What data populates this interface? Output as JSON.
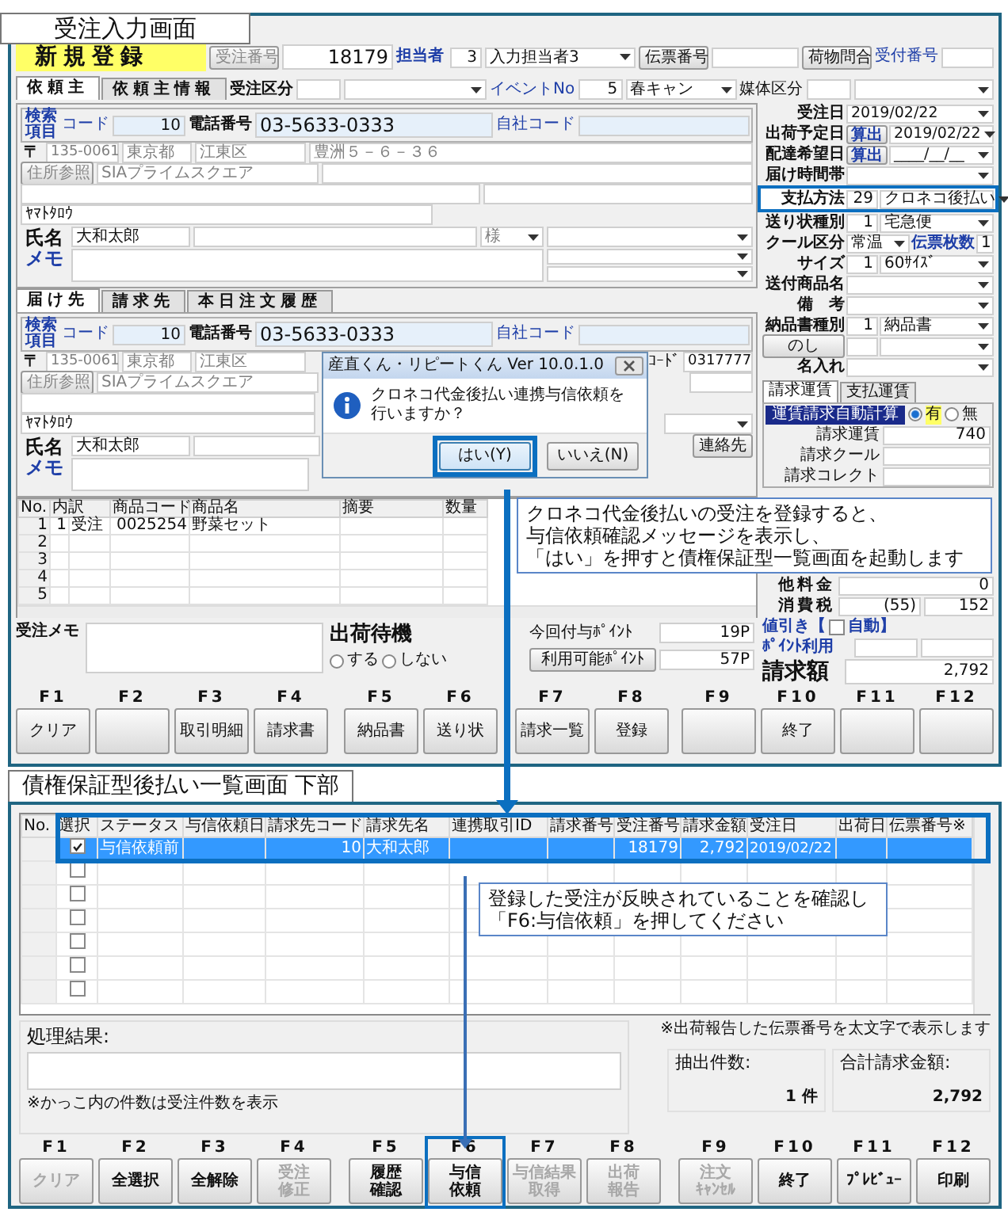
{
  "order_screen": {
    "caption": "受注入力画面",
    "mode": "新規登録",
    "order_no": {
      "button": "受注番号",
      "value": "18179"
    },
    "staff": {
      "label": "担当者",
      "code": "3",
      "name": "入力担当者3"
    },
    "slip_no": {
      "button": "伝票番号"
    },
    "parcel_button": "荷物問合",
    "receipt_label": "受付番号",
    "client_tabs": [
      {
        "label": "依頼主",
        "selected": true
      },
      {
        "label": "依頼主情報",
        "selected": false
      }
    ],
    "order_type": {
      "label": "受注区分"
    },
    "event": {
      "label": "イベントNo",
      "code": "5",
      "name": "春キャン"
    },
    "media": {
      "label": "媒体区分"
    },
    "client": {
      "search_label": "検索項目",
      "code_label": "コード",
      "code": "10",
      "phone_label": "電話番号",
      "phone": "03-5633-0333",
      "own_code_label": "自社コード",
      "zip_mark": "〒",
      "zip": "135-0061",
      "prefecture": "東京都",
      "city": "江東区",
      "street": "豊洲５－６－３６",
      "address_button": "住所参照",
      "building": "SIAプライムスクエア",
      "kana": "ﾔﾏﾄﾀﾛｳ",
      "name_label": "氏名",
      "name": "大和太郎",
      "honorific": "様",
      "memo_label": "メモ"
    },
    "delivery_tabs": [
      {
        "label": "届け先",
        "selected": true
      },
      {
        "label": "請求先",
        "selected": false
      },
      {
        "label": "本日注文履歴",
        "selected": false
      }
    ],
    "delivery": {
      "search_label": "検索項目",
      "code_label": "コード",
      "code": "10",
      "phone_label": "電話番号",
      "phone": "03-5633-0333",
      "own_code_label": "自社コード",
      "zip_mark": "〒",
      "zip": "135-0061",
      "prefecture": "東京都",
      "city": "江東区",
      "address_button": "住所参照",
      "building": "SIAプライムスクエア",
      "kana": "ﾔﾏﾄﾀﾛｳ",
      "name_label": "氏名",
      "name": "大和太郎",
      "memo_label": "メモ",
      "customer_code_label": "ｺｰﾄﾞ",
      "customer_code": "0317777",
      "contact_button": "連絡先"
    },
    "items": {
      "columns": [
        {
          "label": "No."
        },
        {
          "label": "内訳"
        },
        {
          "label": "商品コード"
        },
        {
          "label": "商品名"
        },
        {
          "label": "摘要"
        },
        {
          "label": "数量"
        }
      ],
      "rows": [
        {
          "no": "1",
          "cells": [
            "1",
            "受注",
            "0025254",
            "野菜セット"
          ]
        },
        {
          "no": "2"
        },
        {
          "no": "3"
        },
        {
          "no": "4"
        },
        {
          "no": "5"
        }
      ]
    },
    "memo_label": "受注メモ",
    "shipping_hold": {
      "label": "出荷待機",
      "options": [
        {
          "label": "する",
          "selected": false
        },
        {
          "label": "しない",
          "selected": false
        }
      ]
    },
    "points": [
      {
        "kind": "label",
        "label": "今回付与ﾎﾟｲﾝﾄ",
        "value": "19P"
      },
      {
        "kind": "button",
        "label": "利用可能ﾎﾟｲﾝﾄ",
        "value": "57P"
      }
    ],
    "side_fields": [
      {
        "kind": "date",
        "label": "受注日",
        "value": "2019/02/22",
        "highlighted": false
      },
      {
        "kind": "date",
        "label": "出荷予定日",
        "button": "算出",
        "value": "2019/02/22",
        "highlighted": false
      },
      {
        "kind": "date",
        "label": "配達希望日",
        "button": "算出",
        "value": "____/__/__",
        "highlighted": false
      },
      {
        "kind": "select",
        "label": "届け時間帯",
        "highlighted": false
      },
      {
        "kind": "select",
        "label": "支払方法",
        "code": "29",
        "value": "クロネコ後払い",
        "highlighted": true
      },
      {
        "kind": "select",
        "label": "送り状種別",
        "code": "1",
        "value": "宅急便",
        "highlighted": false
      },
      {
        "kind": "split",
        "label": "クール区分",
        "value": "常温",
        "count_label": "伝票枚数",
        "count": "1",
        "highlighted": false
      },
      {
        "kind": "select",
        "label": "サイズ",
        "code": "1",
        "value": "60ｻｲｽﾞ",
        "highlighted": false
      },
      {
        "kind": "select",
        "label": "送付商品名",
        "highlighted": false
      },
      {
        "kind": "select",
        "label": "備　考",
        "highlighted": false
      },
      {
        "kind": "select",
        "label": "納品書種別",
        "code": "1",
        "value": "納品書",
        "highlighted": false
      },
      {
        "kind": "button",
        "button": "のし",
        "highlighted": false
      },
      {
        "kind": "select",
        "label": "名入れ",
        "highlighted": false
      }
    ],
    "freight": {
      "tabs": [
        {
          "label": "請求運賃",
          "selected": true
        },
        {
          "label": "支払運賃",
          "selected": false
        }
      ],
      "auto_label": "運賃請求自動計算",
      "options": [
        {
          "label": "有",
          "selected": true
        },
        {
          "label": "無",
          "selected": false
        }
      ],
      "rows": [
        {
          "label": "請求運賃",
          "value": "740"
        },
        {
          "label": "請求クール"
        },
        {
          "label": "請求コレクト"
        }
      ]
    },
    "totals": [
      {
        "label": "他料金",
        "value": "0"
      },
      {
        "label": "消費税",
        "note": "(55)",
        "value": "152"
      }
    ],
    "discount": {
      "label": "値引き【",
      "checkbox_label": "自動】",
      "checked": false
    },
    "point_use_label": "ﾎﾟｲﾝﾄ利用",
    "billing": {
      "label": "請求額",
      "value": "2,792"
    },
    "function_keys": [
      {
        "key": "F1",
        "label": "クリア"
      },
      {
        "key": "F2"
      },
      {
        "key": "F3",
        "label": "取引明細"
      },
      {
        "key": "F4",
        "label": "請求書"
      },
      {
        "key": "F5",
        "label": "納品書"
      },
      {
        "key": "F6",
        "label": "送り状"
      },
      {
        "key": "F7",
        "label": "請求一覧"
      },
      {
        "key": "F8",
        "label": "登録"
      },
      {
        "key": "F9"
      },
      {
        "key": "F10",
        "label": "終了"
      },
      {
        "key": "F11"
      },
      {
        "key": "F12"
      }
    ],
    "dialog": {
      "title": "産直くん・リピートくん Ver 10.0.1.0",
      "message": "クロネコ代金後払い連携与信依頼を行いますか？",
      "buttons": [
        {
          "label": "はい(Y)",
          "selected": true
        },
        {
          "label": "いいえ(N)",
          "selected": false
        }
      ]
    },
    "note_lines": [
      "クロネコ代金後払いの受注を登録すると、",
      "与信依頼確認メッセージを表示し、",
      "「はい」を押すと債権保証型一覧画面を起動します"
    ]
  },
  "list_screen": {
    "caption": "債権保証型後払い一覧画面 下部",
    "columns": [
      "No.",
      "選択",
      "ステータス",
      "与信依頼日",
      "請求先コード",
      "請求先名",
      "連携取引ID",
      "請求番号",
      "受注番号",
      "請求金額",
      "受注日",
      "出荷日",
      "伝票番号※"
    ],
    "rows": [
      {
        "selected": true,
        "checked": true,
        "cells": [
          "与信依頼前",
          null,
          "10",
          "大和太郎",
          null,
          null,
          "18179",
          "2,792",
          "2019/02/22",
          null,
          null
        ]
      },
      {
        "selected": false,
        "checked": false
      },
      {
        "selected": false,
        "checked": false
      },
      {
        "selected": false,
        "checked": false
      },
      {
        "selected": false,
        "checked": false
      },
      {
        "selected": false,
        "checked": false
      },
      {
        "selected": false,
        "checked": false
      }
    ],
    "result_label": "処理結果:",
    "result_note": "※かっこ内の件数は受注件数を表示",
    "bold_note": "※出荷報告した伝票番号を太文字で表示します",
    "count": {
      "label": "抽出件数:",
      "value": "1 件"
    },
    "total": {
      "label": "合計請求金額:",
      "value": "2,792"
    },
    "function_keys": [
      {
        "key": "F1",
        "label": "クリア",
        "disabled": true,
        "highlighted": false
      },
      {
        "key": "F2",
        "label": "全選択",
        "disabled": false,
        "highlighted": false
      },
      {
        "key": "F3",
        "label": "全解除",
        "disabled": false,
        "highlighted": false
      },
      {
        "key": "F4",
        "lines": [
          "受注",
          "修正"
        ],
        "disabled": true,
        "highlighted": false
      },
      {
        "key": "F5",
        "lines": [
          "履歴",
          "確認"
        ],
        "disabled": false,
        "highlighted": false
      },
      {
        "key": "F6",
        "lines": [
          "与信",
          "依頼"
        ],
        "disabled": false,
        "highlighted": true
      },
      {
        "key": "F7",
        "lines": [
          "与信結果",
          "取得"
        ],
        "disabled": true,
        "highlighted": false
      },
      {
        "key": "F8",
        "lines": [
          "出荷",
          "報告"
        ],
        "disabled": true,
        "highlighted": false
      },
      {
        "key": "F9",
        "lines": [
          "注文",
          "ｷｬﾝｾﾙ"
        ],
        "disabled": true,
        "highlighted": false
      },
      {
        "key": "F10",
        "label": "終了",
        "disabled": false,
        "highlighted": false
      },
      {
        "key": "F11",
        "label": "ﾌﾟﾚﾋﾞｭｰ",
        "disabled": false,
        "highlighted": false
      },
      {
        "key": "F12",
        "label": "印刷",
        "disabled": false,
        "highlighted": false
      }
    ],
    "note_lines": [
      "登録した受注が反映されていることを確認し",
      "「F6:与信依頼」を押してください"
    ]
  }
}
